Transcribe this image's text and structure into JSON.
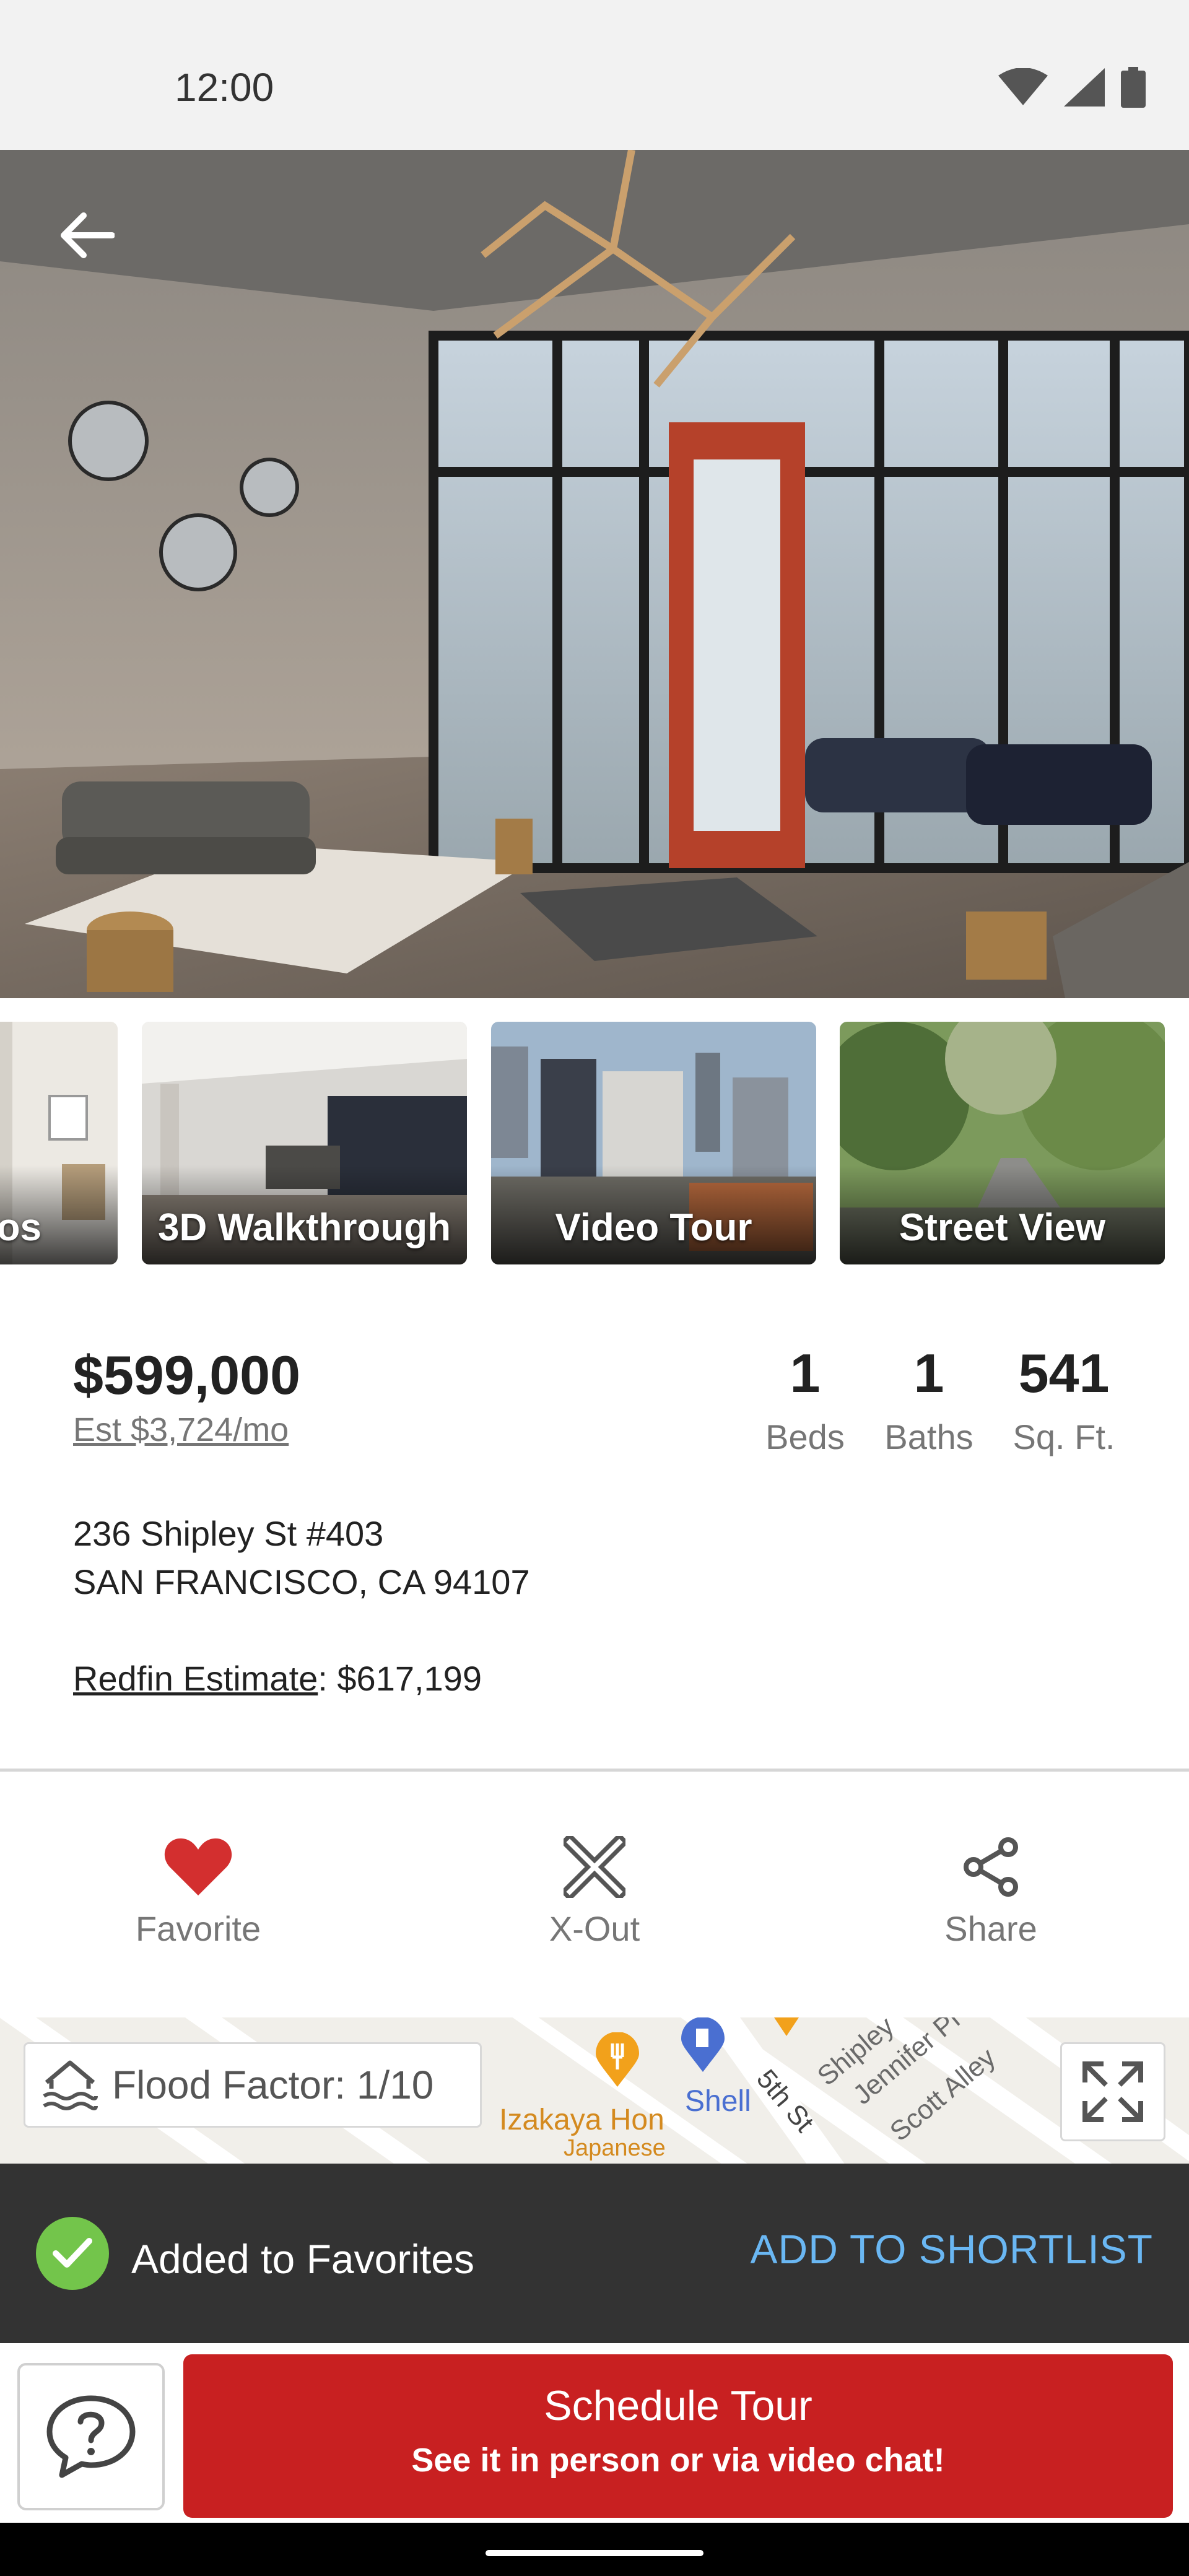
{
  "status_bar": {
    "time": "12:00",
    "icons": [
      "wifi-icon",
      "signal-icon",
      "battery-icon"
    ]
  },
  "hero": {
    "back_icon": "arrow-left-icon"
  },
  "thumbnails": [
    {
      "label": "tos"
    },
    {
      "label": "3D Walkthrough"
    },
    {
      "label": "Video Tour"
    },
    {
      "label": "Street View"
    }
  ],
  "listing": {
    "price": "$599,000",
    "est_monthly": "Est $3,724/mo",
    "beds_value": "1",
    "beds_label": "Beds",
    "baths_value": "1",
    "baths_label": "Baths",
    "sqft_value": "541",
    "sqft_label": "Sq. Ft.",
    "address_line1": "236 Shipley St #403",
    "address_line2": "SAN FRANCISCO, CA 94107",
    "redfin_estimate_link": "Redfin Estimate",
    "redfin_estimate_value": ": $617,199"
  },
  "actions": {
    "favorite": "Favorite",
    "xout": "X-Out",
    "share": "Share"
  },
  "map": {
    "flood_factor": "Flood Factor: 1/10",
    "labels": {
      "izakaya": "Izakaya Hon",
      "japanese": "Japanese",
      "shell": "Shell",
      "fifth_st": "5th St",
      "shipley": "Shipley",
      "jennifer": "Jennifer Pl",
      "scott": "Scott Alley"
    }
  },
  "snackbar": {
    "message": "Added to Favorites",
    "action": "ADD TO SHORTLIST"
  },
  "bottom": {
    "schedule_title": "Schedule Tour",
    "schedule_sub": "See it in person or via video chat!"
  },
  "colors": {
    "brand_red": "#c82021",
    "favorite_red": "#d32f2f",
    "snackbar_bg": "#333333",
    "snackbar_action": "#6ab7f3",
    "success_green": "#73c54b"
  }
}
